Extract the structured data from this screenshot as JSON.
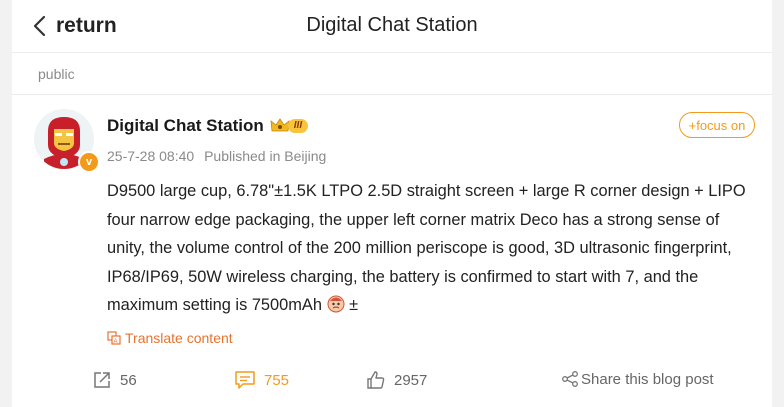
{
  "header": {
    "back_label": "return",
    "title": "Digital Chat Station"
  },
  "section": {
    "label": "public"
  },
  "post": {
    "author": "Digital Chat Station",
    "level_badge": "III",
    "verified_badge": "v",
    "follow_label": "+focus on",
    "timestamp": "25-7-28 08:40",
    "location": "Published in Beijing",
    "content": "D9500 large cup, 6.78\"±1.5K LTPO 2.5D straight screen + large R corner design + LIPO four narrow edge packaging, the upper left corner matrix Deco has a strong sense of unity, the volume control of the 200 million periscope is good, 3D ultrasonic fingerprint, IP68/IP69, 50W wireless charging, the battery is confirmed to start with 7, and the maximum setting is 7500mAh",
    "content_suffix": "±",
    "translate_label": "Translate content"
  },
  "actions": {
    "share_count": "56",
    "comment_count": "755",
    "like_count": "2957",
    "share_label": "Share this blog post"
  },
  "colors": {
    "accent": "#f39a1d",
    "translate": "#e8732e",
    "muted": "#8a8a8a"
  },
  "icons": {
    "back": "chevron-left-icon",
    "forward": "share-arrow-icon",
    "comment": "comment-icon",
    "like": "thumbs-up-icon",
    "share": "share-icon",
    "translate": "translate-icon"
  }
}
